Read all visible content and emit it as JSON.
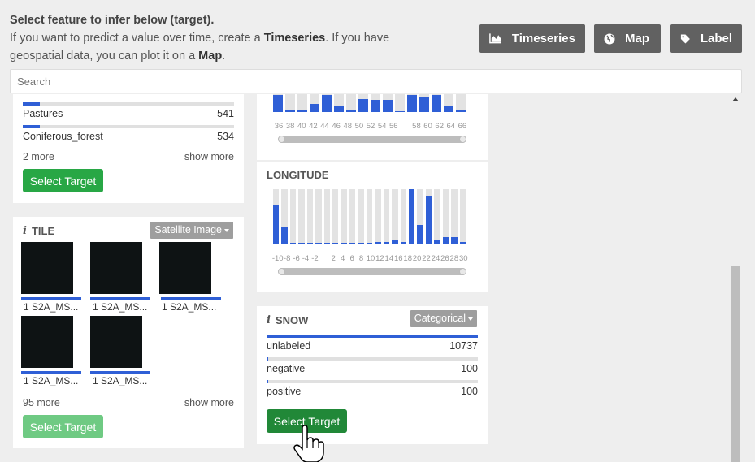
{
  "header": {
    "title": "Select feature to infer below (target).",
    "line1_pre": "If you want to predict a value over time, create a ",
    "line1_bold": "Timeseries",
    "line1_post": ". If you have",
    "line2_pre": "geospatial data, you can plot it on a ",
    "line2_bold": "Map",
    "line2_post": "."
  },
  "toolbar": {
    "timeseries": "Timeseries",
    "map": "Map",
    "label": "Label"
  },
  "search": {
    "placeholder": "Search"
  },
  "card1": {
    "rows": [
      {
        "label": "Pastures",
        "value": "541",
        "fraction": 0.05
      },
      {
        "label": "Coniferous_forest",
        "value": "534",
        "fraction": 0.05
      }
    ],
    "more": "2 more",
    "show_more": "show more",
    "select": "Select Target"
  },
  "tile": {
    "title": "TILE",
    "dropdown": "Satellite Image",
    "thumbs": [
      "1 S2A_MS...",
      "1 S2A_MS...",
      "1 S2A_MS...",
      "1 S2A_MS...",
      "1 S2A_MS..."
    ],
    "more": "95 more",
    "show_more": "show more",
    "select": "Select Target"
  },
  "latitude": {
    "ticks": [
      "36",
      "38",
      "40",
      "42",
      "44",
      "46",
      "48",
      "50",
      "52",
      "54",
      "56",
      "",
      "58",
      "60",
      "62",
      "64",
      "66"
    ],
    "values": [
      0.95,
      0.05,
      0.1,
      0.45,
      0.95,
      0.35,
      0.05,
      0.75,
      0.7,
      0.7,
      0.0,
      0.95,
      0.8,
      0.95,
      0.35,
      0.05
    ]
  },
  "longitude": {
    "title": "LONGITUDE",
    "ticks": [
      "-10",
      "-8",
      "-6",
      "-4",
      "-2",
      "",
      "2",
      "4",
      "6",
      "8",
      "10",
      "12",
      "14",
      "16",
      "18",
      "20",
      "22",
      "24",
      "26",
      "28",
      "30"
    ],
    "values": [
      0.7,
      0.31,
      0.0,
      0.0,
      0.0,
      0.0,
      0.0,
      0.0,
      0.0,
      0.0,
      0.0,
      0.0,
      0.02,
      0.02,
      0.08,
      0.02,
      1.0,
      0.34,
      0.88,
      0.06,
      0.12,
      0.12,
      0.02
    ]
  },
  "snow": {
    "title": "SNOW",
    "dropdown": "Categorical",
    "rows": [
      {
        "label": "unlabeled",
        "value": "10737",
        "fraction": 1.0
      },
      {
        "label": "negative",
        "value": "100",
        "fraction": 0.01
      },
      {
        "label": "positive",
        "value": "100",
        "fraction": 0.01
      }
    ],
    "select": "Select Target"
  },
  "colors": {
    "accent": "#2f5fd6",
    "success": "#28a745",
    "button_dark": "#616161"
  }
}
